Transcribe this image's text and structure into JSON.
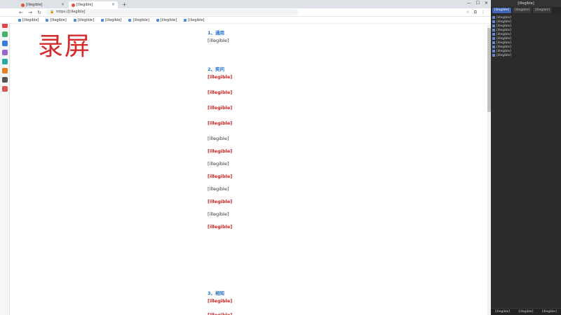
{
  "browser": {
    "tabs": [
      {
        "label": "[illegible]",
        "active": false
      },
      {
        "label": "[illegible]",
        "active": true
      }
    ],
    "url": "https://[illegible]",
    "bookmarks": [
      "[illegible]",
      "[illegible]",
      "[illegible]",
      "[illegible]",
      "[illegible]",
      "[illegible]",
      "[illegible]"
    ]
  },
  "content": {
    "rec_label": "录屏",
    "sections": [
      {
        "title": "1、通用",
        "lines": [
          {
            "text": "[illegible]",
            "style": "plain"
          }
        ]
      },
      {
        "title": "2、奕问",
        "lines": [
          {
            "text": "[illegible]",
            "style": "red"
          },
          {
            "text": "[illegible]",
            "style": "red"
          },
          {
            "text": "[illegible]",
            "style": "red"
          },
          {
            "text": "[illegible]",
            "style": "red"
          },
          {
            "text": "[illegible]",
            "style": "plain"
          },
          {
            "text": "[illegible]",
            "style": "red"
          },
          {
            "text": "[illegible]",
            "style": "plain"
          },
          {
            "text": "[illegible]",
            "style": "red"
          },
          {
            "text": "[illegible]",
            "style": "plain"
          },
          {
            "text": "[illegible]",
            "style": "red"
          },
          {
            "text": "[illegible]",
            "style": "plain"
          },
          {
            "text": "[illegible]",
            "style": "red"
          }
        ]
      },
      {
        "title": "3、相知",
        "lines": [
          {
            "text": "[illegible]",
            "style": "red"
          },
          {
            "text": "[illegible]",
            "style": "red"
          }
        ]
      }
    ]
  },
  "panel": {
    "title": "[illegible]",
    "tabs": [
      {
        "label": "[illegible]",
        "active": true
      },
      {
        "label": "[illegible]",
        "active": false
      },
      {
        "label": "[illegible]",
        "active": false
      }
    ],
    "files": [
      "[illegible]",
      "[illegible]",
      "[illegible]",
      "[illegible]",
      "[illegible]",
      "[illegible]",
      "[illegible]",
      "[illegible]",
      "[illegible]",
      "[illegible]"
    ],
    "footer": [
      "[illegible]",
      "[illegible]",
      "[illegible]"
    ]
  },
  "colors": {
    "red": "#d42020",
    "link": "#1f6fd1"
  }
}
